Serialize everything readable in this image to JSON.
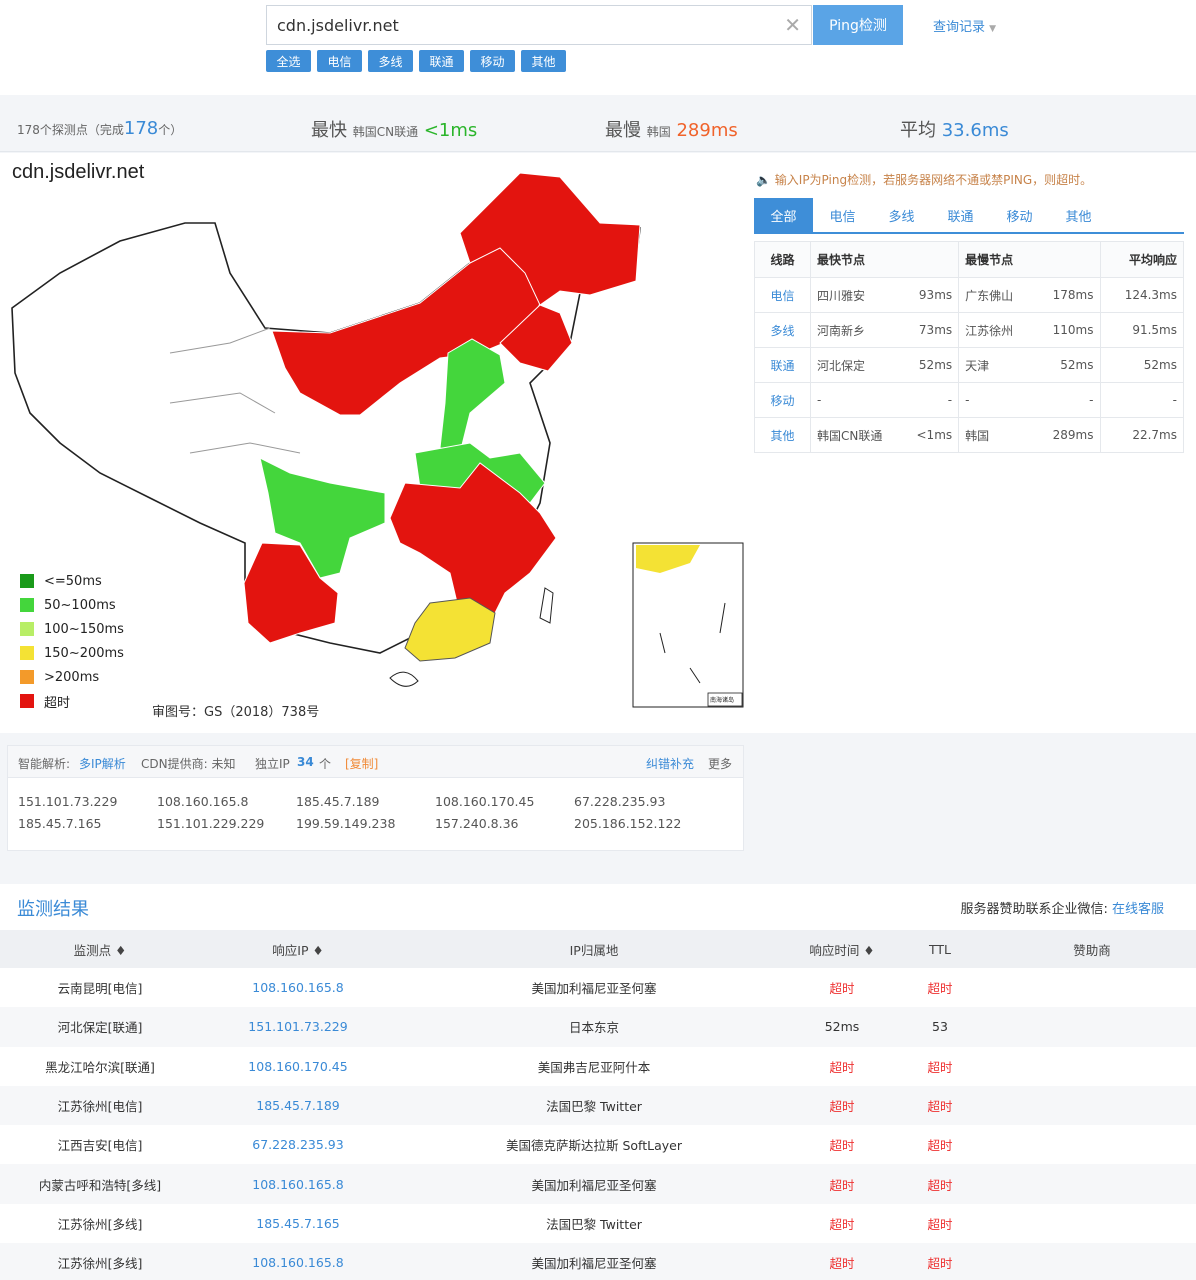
{
  "search": {
    "value": "cdn.jsdelivr.net",
    "ping_label": "Ping检测",
    "history_label": "查询记录"
  },
  "filters": [
    "全选",
    "电信",
    "多线",
    "联通",
    "移动",
    "其他"
  ],
  "stats": {
    "probes_text": "178个探测点（完成",
    "probes_done": "178",
    "probes_unit": "个）",
    "fastest_label": "最快",
    "fastest_node": "韩国CN联通",
    "fastest_value": "<1ms",
    "slowest_label": "最慢",
    "slowest_node": "韩国",
    "slowest_value": "289ms",
    "avg_label": "平均",
    "avg_value": "33.6ms"
  },
  "map": {
    "title": "cdn.jsdelivr.net",
    "legend": [
      {
        "label": "<=50ms",
        "color": "#1a9a1a"
      },
      {
        "label": "50~100ms",
        "color": "#44d63c"
      },
      {
        "label": "100~150ms",
        "color": "#b8ee66"
      },
      {
        "label": "150~200ms",
        "color": "#f4e234"
      },
      {
        "label": ">200ms",
        "color": "#f39a2a"
      },
      {
        "label": "超时",
        "color": "#e3140f"
      }
    ],
    "approval": "审图号：GS（2018）738号",
    "inset_title": "南海诸岛"
  },
  "notice": "输入IP为Ping检测，若服务器网络不通或禁PING，则超时。",
  "line_tabs": [
    "全部",
    "电信",
    "多线",
    "联通",
    "移动",
    "其他"
  ],
  "line_table": {
    "headers": [
      "线路",
      "最快节点",
      "",
      "最慢节点",
      "",
      "平均响应"
    ],
    "rows": [
      [
        "电信",
        "四川雅安",
        "93ms",
        "广东佛山",
        "178ms",
        "124.3ms"
      ],
      [
        "多线",
        "河南新乡",
        "73ms",
        "江苏徐州",
        "110ms",
        "91.5ms"
      ],
      [
        "联通",
        "河北保定",
        "52ms",
        "天津",
        "52ms",
        "52ms"
      ],
      [
        "移动",
        "-",
        "-",
        "-",
        "-",
        "-"
      ],
      [
        "其他",
        "韩国CN联通",
        "<1ms",
        "韩国",
        "289ms",
        "22.7ms"
      ]
    ]
  },
  "dns": {
    "smart_label": "智能解析:",
    "smart_link": "多IP解析",
    "cdn_label": "CDN提供商: 未知",
    "ip_label": "独立IP",
    "ip_count": "34",
    "ip_unit": "个",
    "copy_label": "[复制]",
    "correct_label": "纠错补充",
    "more_label": "更多",
    "ips_row1": [
      "151.101.73.229",
      "108.160.165.8",
      "185.45.7.189",
      "108.160.170.45",
      "67.228.235.93"
    ],
    "ips_row2": [
      "185.45.7.165",
      "151.101.229.229",
      "199.59.149.238",
      "157.240.8.36",
      "205.186.152.122"
    ]
  },
  "results": {
    "title": "监测结果",
    "sponsor_text": "服务器赞助联系企业微信:",
    "sponsor_link": "在线客服",
    "headers": [
      "监测点 ♦",
      "响应IP ♦",
      "IP归属地",
      "响应时间 ♦",
      "TTL",
      "赞助商"
    ],
    "rows": [
      [
        "云南昆明[电信]",
        "108.160.165.8",
        "美国加利福尼亚圣何塞",
        "超时",
        "超时",
        ""
      ],
      [
        "河北保定[联通]",
        "151.101.73.229",
        "日本东京",
        "52ms",
        "53",
        ""
      ],
      [
        "黑龙江哈尔滨[联通]",
        "108.160.170.45",
        "美国弗吉尼亚阿什本",
        "超时",
        "超时",
        ""
      ],
      [
        "江苏徐州[电信]",
        "185.45.7.189",
        "法国巴黎 Twitter",
        "超时",
        "超时",
        ""
      ],
      [
        "江西吉安[电信]",
        "67.228.235.93",
        "美国德克萨斯达拉斯 SoftLayer",
        "超时",
        "超时",
        ""
      ],
      [
        "内蒙古呼和浩特[多线]",
        "108.160.165.8",
        "美国加利福尼亚圣何塞",
        "超时",
        "超时",
        ""
      ],
      [
        "江苏徐州[多线]",
        "185.45.7.165",
        "法国巴黎 Twitter",
        "超时",
        "超时",
        ""
      ],
      [
        "江苏徐州[多线]",
        "108.160.165.8",
        "美国加利福尼亚圣何塞",
        "超时",
        "超时",
        ""
      ]
    ]
  }
}
